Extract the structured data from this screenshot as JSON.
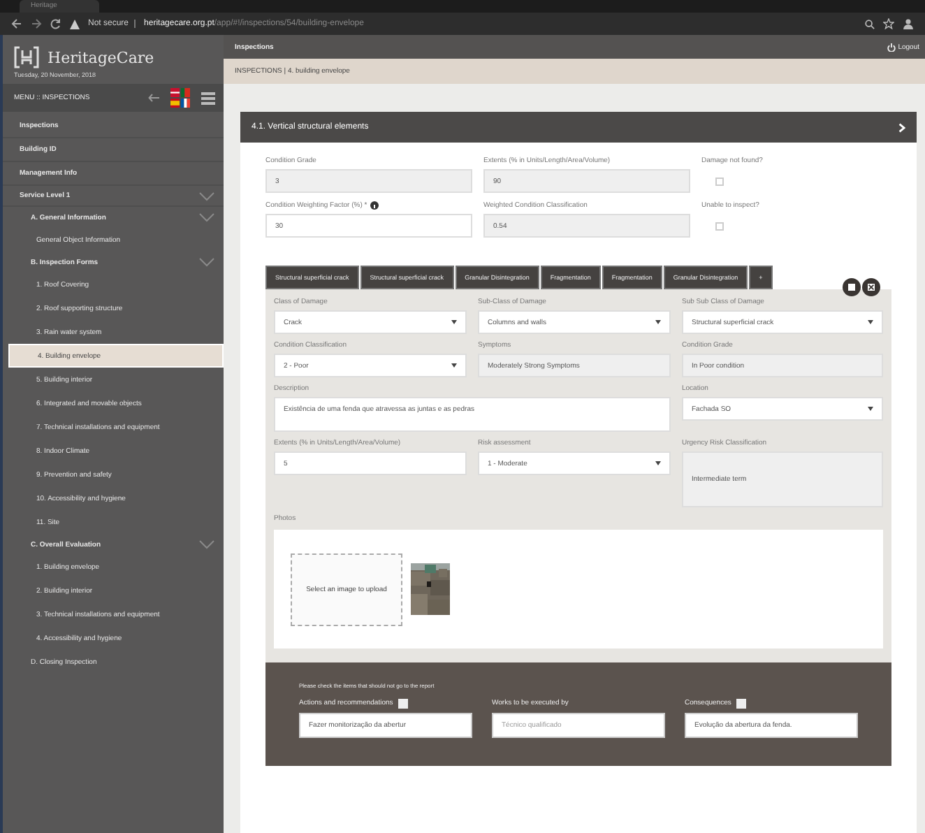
{
  "browser": {
    "tab_title": "Heritage",
    "security": "Not secure",
    "url_host": "heritagecare.org.pt",
    "url_path": "/app/#!/inspections/54/building-envelope"
  },
  "sidebar": {
    "logo": "HeritageCare",
    "date": "Tuesday, 20 November, 2018",
    "menu_title": "MENU :: INSPECTIONS",
    "items": [
      {
        "label": "Inspections",
        "selected": false
      },
      {
        "label": "Building ID",
        "selected": false
      },
      {
        "label": "Management Info",
        "selected": false
      },
      {
        "label": "Service Level 1",
        "expanded": true,
        "children": [
          {
            "label": "A. General Information",
            "expanded": true,
            "children": [
              {
                "label": "General Object Information",
                "selected": false
              }
            ]
          },
          {
            "label": "B. Inspection Forms",
            "expanded": true,
            "children": [
              {
                "label": "1. Roof Covering",
                "selected": false
              },
              {
                "label": "2. Roof supporting structure",
                "selected": false
              },
              {
                "label": "3. Rain water system",
                "selected": false
              },
              {
                "label": "4. Building envelope",
                "selected": true
              },
              {
                "label": "5. Building interior",
                "selected": false
              },
              {
                "label": "6. Integrated and movable objects",
                "selected": false
              },
              {
                "label": "7. Technical installations and equipment",
                "selected": false
              },
              {
                "label": "8. Indoor Climate",
                "selected": false
              },
              {
                "label": "9. Prevention and safety",
                "selected": false
              },
              {
                "label": "10. Accessibility and hygiene",
                "selected": false
              },
              {
                "label": "11. Site",
                "selected": false
              }
            ]
          },
          {
            "label": "C. Overall Evaluation",
            "expanded": true,
            "children": [
              {
                "label": "1. Building envelope",
                "selected": false
              },
              {
                "label": "2. Building interior",
                "selected": false
              },
              {
                "label": "3. Technical installations and equipment",
                "selected": false
              },
              {
                "label": "4. Accessibility and hygiene",
                "selected": false
              }
            ]
          },
          {
            "label": "D. Closing Inspection",
            "selected": false
          }
        ]
      }
    ]
  },
  "header": {
    "title": "Inspections",
    "logout": "Logout",
    "breadcrumb": "INSPECTIONS | 4. building envelope"
  },
  "section": {
    "title": "4.1. Vertical structural elements",
    "fields": [
      {
        "kind": "readonly",
        "label": "Condition Grade",
        "value": "3"
      },
      {
        "kind": "readonly",
        "label": "Extents (% in Units/Length/Area/Volume)",
        "value": "90"
      },
      {
        "kind": "checkbox",
        "label": "Damage not found?",
        "checked": false
      },
      {
        "kind": "input",
        "label": "Condition Weighting Factor (%) *",
        "info": true,
        "value": "30"
      },
      {
        "kind": "readonly",
        "label": "Weighted Condition Classification",
        "value": "0.54"
      },
      {
        "kind": "checkbox",
        "label": "Unable to inspect?",
        "checked": false
      }
    ]
  },
  "damage_tabs": [
    "Structural superficial crack",
    "Structural superficial crack",
    "Granular Disintegration",
    "Fragmentation",
    "Fragmentation",
    "Granular Disintegration"
  ],
  "add_tab": "+",
  "damage_fields": [
    {
      "kind": "select",
      "label": "Class of Damage",
      "value": "Crack"
    },
    {
      "kind": "select",
      "label": "Sub-Class of Damage",
      "value": "Columns and walls"
    },
    {
      "kind": "select",
      "label": "Sub Sub Class of Damage",
      "value": "Structural superficial crack"
    },
    {
      "kind": "select",
      "label": "Condition Classification",
      "value": "2 - Poor"
    },
    {
      "kind": "readonly",
      "label": "Symptoms",
      "value": "Moderately Strong Symptoms"
    },
    {
      "kind": "readonly",
      "label": "Condition Grade",
      "value": "In Poor condition"
    },
    {
      "kind": "textarea",
      "label": "Description",
      "value": "Existência de uma fenda que atravessa as juntas e as pedras"
    },
    {
      "kind": "select",
      "label": "Location",
      "value": "Fachada SO"
    },
    {
      "kind": "input",
      "label": "Extents (% in Units/Length/Area/Volume)",
      "value": "5"
    },
    {
      "kind": "select",
      "label": "Risk assessment",
      "value": "1 - Moderate"
    },
    {
      "kind": "tall",
      "label": "Urgency Risk Classification",
      "value": "Intermediate term"
    }
  ],
  "photos": {
    "label": "Photos",
    "upload": "Select an image to upload"
  },
  "report": {
    "note": "Please check the items that should not go to the report",
    "fields": [
      {
        "label": "Actions and recommendations",
        "checked": false,
        "value": "Fazer monitorização da abertur"
      },
      {
        "label": "Works to be executed by",
        "placeholder": "Técnico qualificado"
      },
      {
        "label": "Consequences",
        "checked": false,
        "value": "Evolução da abertura da fenda."
      }
    ]
  }
}
